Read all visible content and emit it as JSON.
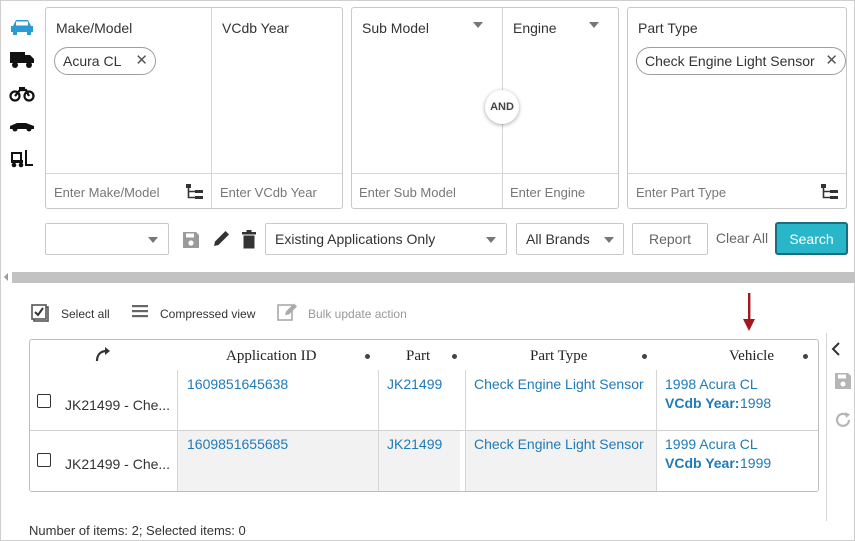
{
  "filters": {
    "make_model": {
      "title": "Make/Model",
      "chip": "Acura CL",
      "placeholder": "Enter Make/Model"
    },
    "vcdb_year": {
      "title": "VCdb Year",
      "placeholder": "Enter VCdb Year"
    },
    "sub_model": {
      "title": "Sub Model",
      "placeholder": "Enter Sub Model"
    },
    "engine": {
      "title": "Engine",
      "placeholder": "Enter Engine"
    },
    "and_label": "AND",
    "part_type": {
      "title": "Part Type",
      "chip": "Check Engine Light Sensor",
      "placeholder": "Enter Part Type"
    }
  },
  "toolbar": {
    "saved_search_value": "",
    "applications_select": "Existing Applications Only",
    "brands_select": "All Brands",
    "report_label": "Report",
    "clear_all_label": "Clear All",
    "search_label": "Search"
  },
  "grid_actions": {
    "select_all": "Select all",
    "compressed_view": "Compressed view",
    "bulk_update": "Bulk update action"
  },
  "table": {
    "headers": {
      "application_id": "Application ID",
      "part": "Part",
      "part_type": "Part Type",
      "vehicle": "Vehicle"
    },
    "rows": [
      {
        "name": "JK21499 - Che...",
        "application_id": "1609851645638",
        "part": "JK21499",
        "part_type": "Check Engine Light Sensor",
        "vehicle": "1998 Acura CL",
        "vcdb_label": "VCdb Year:",
        "vcdb_value": "1998"
      },
      {
        "name": "JK21499 - Che...",
        "application_id": "1609851655685",
        "part": "JK21499",
        "part_type": "Check Engine Light Sensor",
        "vehicle": "1999 Acura CL",
        "vcdb_label": "VCdb Year:",
        "vcdb_value": "1999"
      }
    ]
  },
  "footer": {
    "status": "Number of items: 2; Selected items: 0"
  },
  "colors": {
    "accent": "#2b9bd3",
    "search_bg": "#29b6c9",
    "link": "#1f7ab8",
    "arrow": "#a0191e"
  },
  "icons": [
    "car-icon",
    "truck-icon",
    "motorcycle-icon",
    "race-car-icon",
    "forklift-icon",
    "tree-icon",
    "save-icon",
    "pencil-icon",
    "trash-icon",
    "collapse-icon",
    "refresh-icon",
    "redo-arrow-icon"
  ]
}
